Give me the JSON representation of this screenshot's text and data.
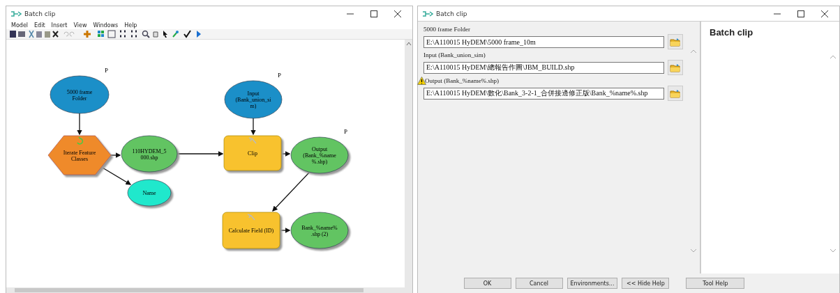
{
  "model_window": {
    "title": "Batch clip",
    "menu": [
      "Model",
      "Edit",
      "Insert",
      "View",
      "Windows",
      "Help"
    ],
    "nodes": [
      {
        "kind": "data",
        "lines": [
          "5000 frame",
          "Folder"
        ],
        "param_mark": "P"
      },
      {
        "kind": "iterator",
        "lines": [
          "Iterate Feature",
          "Classes"
        ]
      },
      {
        "kind": "derived",
        "lines": [
          "110HYDEM_5",
          "000.shp"
        ]
      },
      {
        "kind": "variable",
        "lines": [
          "Name"
        ]
      },
      {
        "kind": "data",
        "lines": [
          "Input",
          "(Bank_union_si",
          "m)"
        ],
        "param_mark": "P"
      },
      {
        "kind": "tool",
        "lines": [
          "Clip"
        ]
      },
      {
        "kind": "derived",
        "lines": [
          "Output",
          "(Bank_%name",
          "%.shp)"
        ],
        "param_mark": "P"
      },
      {
        "kind": "tool",
        "lines": [
          "Calculate Field (ID)"
        ]
      },
      {
        "kind": "derived",
        "lines": [
          "Bank_%name%",
          ".shp (2)"
        ]
      }
    ]
  },
  "tool_dialog": {
    "title": "Batch clip",
    "parameters": [
      {
        "label": "5000 frame Folder",
        "value": "E:\\A110015 HyDEM\\5000 frame_10m",
        "warning": false
      },
      {
        "label": "Input (Bank_union_sim)",
        "value": "E:\\A110015 HyDEM\\總報告作圖\\JBM_BUILD.shp",
        "warning": false
      },
      {
        "label": "Output (Bank_%name%.shp)",
        "value": "E:\\A110015 HyDEM\\數化\\Bank_3-2-1_合併接邊修正版\\Bank_%name%.shp",
        "warning": true
      }
    ],
    "help_title": "Batch clip",
    "buttons": [
      "OK",
      "Cancel",
      "Environments...",
      "<< Hide Help"
    ],
    "help_button": "Tool Help"
  }
}
